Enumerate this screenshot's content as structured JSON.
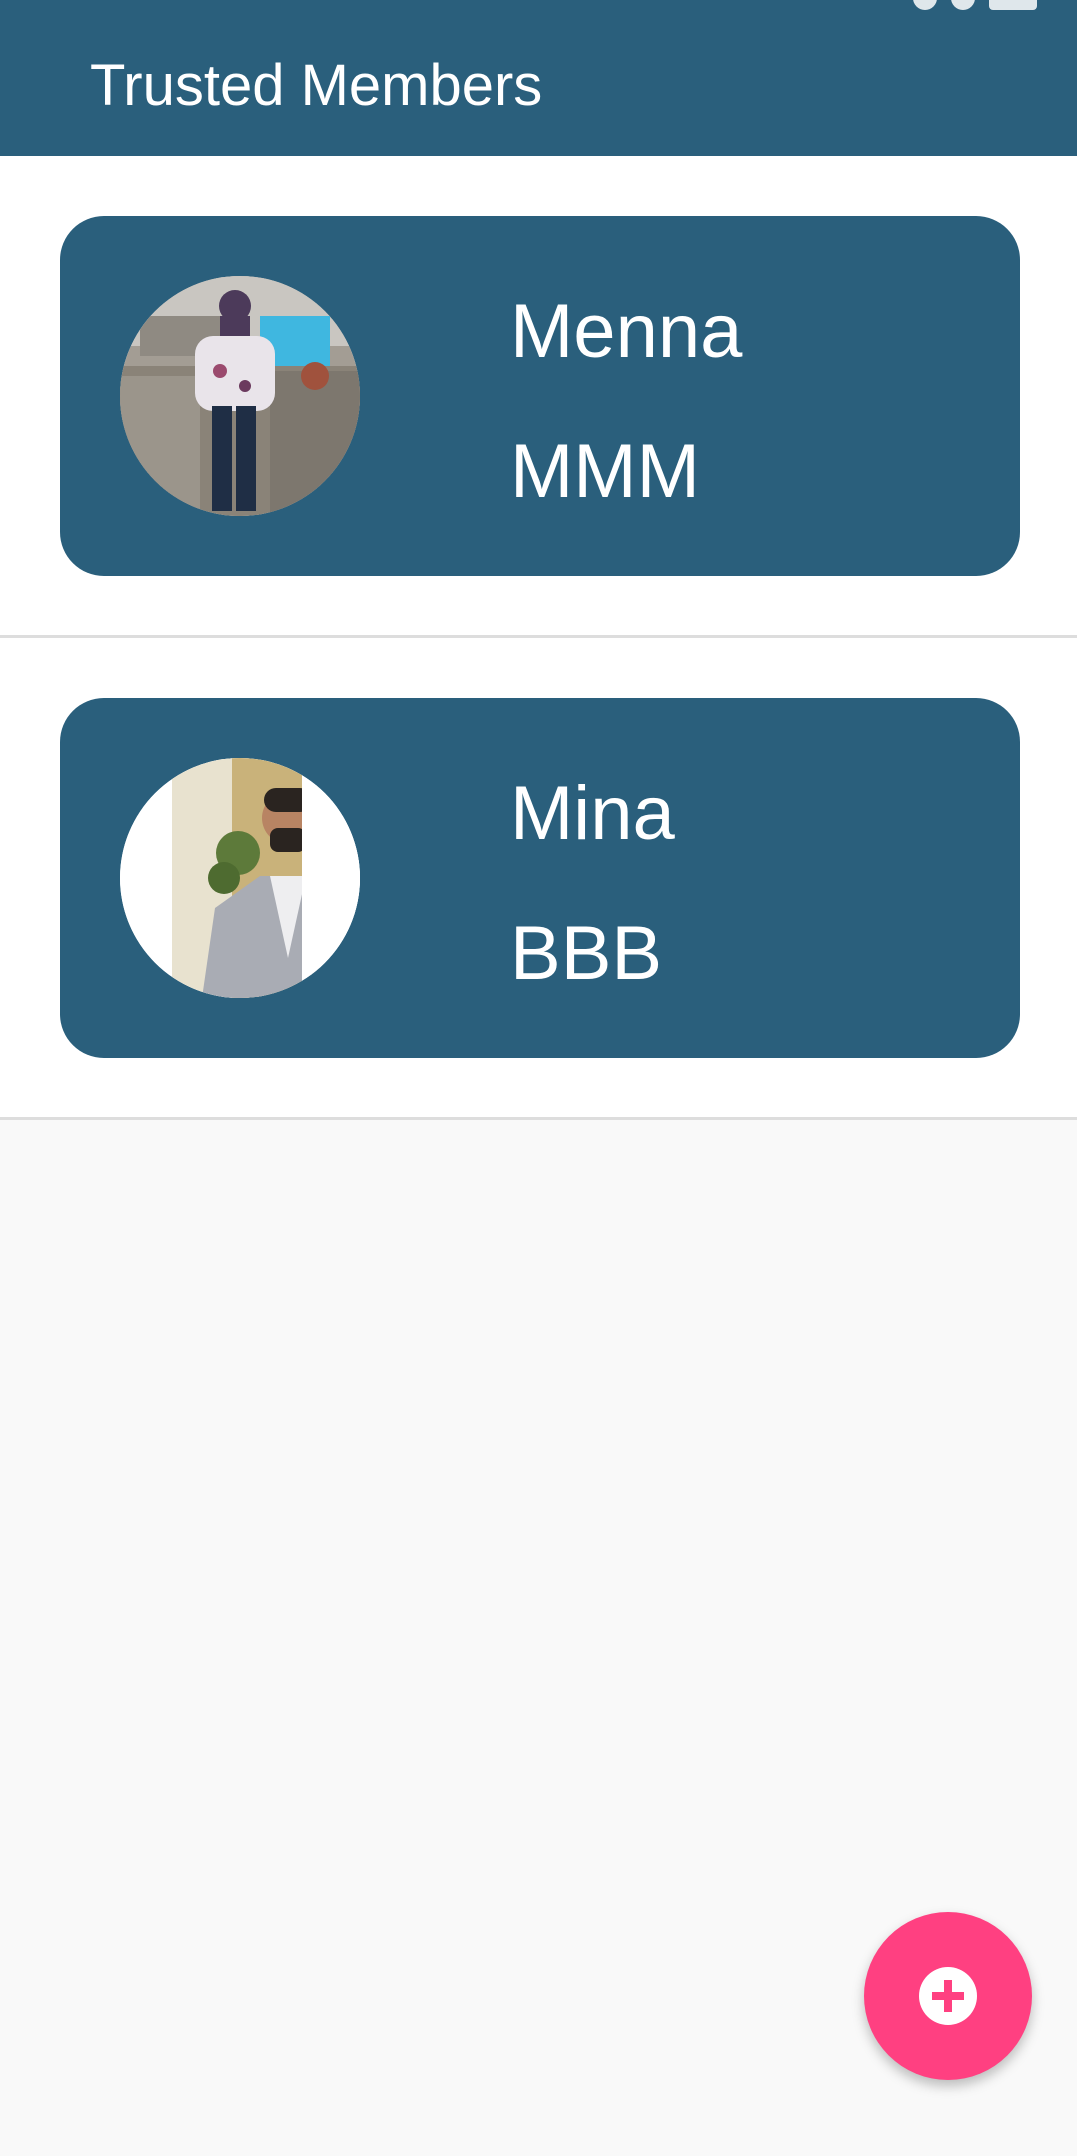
{
  "app_bar": {
    "title": "Trusted Members",
    "color": "#2a5f7c"
  },
  "members": [
    {
      "name": "Menna",
      "code": "MMM",
      "avatar_icon": "member-photo-icon"
    },
    {
      "name": "Mina",
      "code": "BBB",
      "avatar_icon": "member-photo-icon"
    }
  ],
  "fab": {
    "icon": "add-circle-icon",
    "color": "#ff4081"
  }
}
